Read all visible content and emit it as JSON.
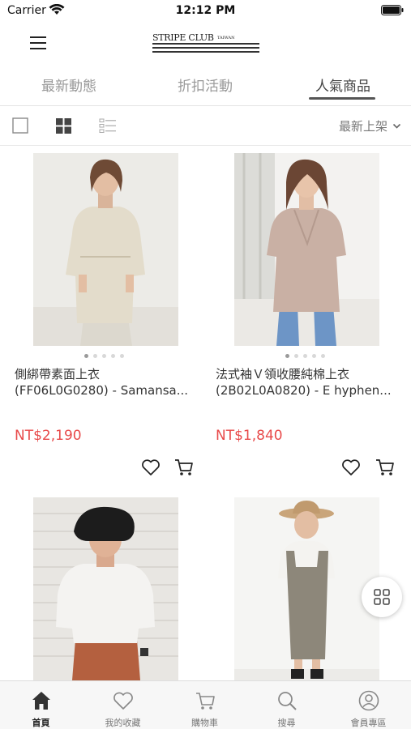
{
  "status_bar": {
    "carrier": "Carrier",
    "time": "12:12 PM"
  },
  "header": {
    "logo_text": "STRIPE CLUB",
    "logo_sub": "TAIWAN"
  },
  "tabs": [
    {
      "label": "最新動態",
      "active": false
    },
    {
      "label": "折扣活動",
      "active": false
    },
    {
      "label": "人氣商品",
      "active": true
    }
  ],
  "toolbar": {
    "sort_label": "最新上架"
  },
  "products": [
    {
      "name": "側綁帶素面上衣",
      "name_line2": "(FF06L0G0280) - Samansa...",
      "price": "NT$2,190"
    },
    {
      "name": "法式袖Ｖ領收腰純棉上衣",
      "name_line2": "(2B02L0A0820) - E hyphen...",
      "price": "NT$1,840"
    }
  ],
  "bottom_nav": [
    {
      "label": "首頁",
      "icon": "home-icon",
      "active": true
    },
    {
      "label": "我的收藏",
      "icon": "heart-icon",
      "active": false
    },
    {
      "label": "購物車",
      "icon": "cart-icon",
      "active": false
    },
    {
      "label": "搜尋",
      "icon": "search-icon",
      "active": false
    },
    {
      "label": "會員專區",
      "icon": "user-icon",
      "active": false
    }
  ],
  "colors": {
    "price": "#e84a4a",
    "accent_underline": "#555555"
  }
}
